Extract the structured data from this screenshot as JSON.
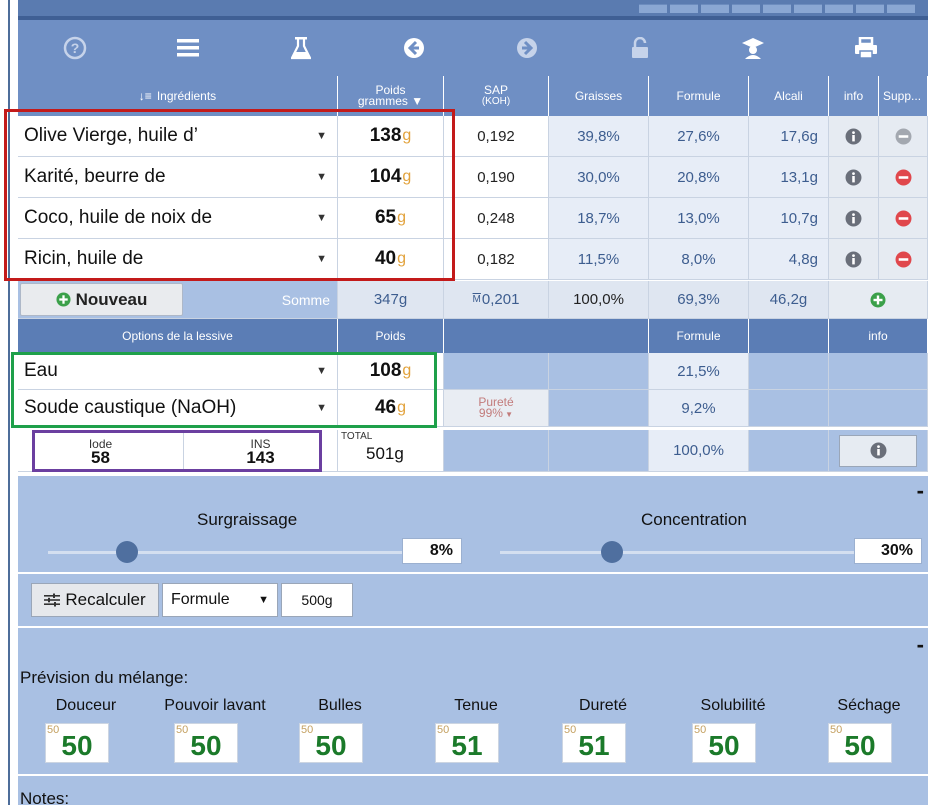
{
  "toolbar": {
    "icons": [
      "help-icon",
      "menu-icon",
      "flask-icon",
      "back-icon",
      "forward-icon",
      "unlock-icon",
      "graduation-icon",
      "print-icon"
    ]
  },
  "headers": {
    "ingredients": "Ingrédients",
    "poids": "Poids",
    "poids_sub": "grammes ▼",
    "sap": "SAP",
    "sap_sub": "(KOH)",
    "graisses": "Graisses",
    "formule": "Formule",
    "alcali": "Alcali",
    "info": "info",
    "supp": "Supp..."
  },
  "ingredients": [
    {
      "name": "Olive Vierge, huile d’",
      "weight": "138",
      "unit": "g",
      "sap": "0,192",
      "graisses": "39,8%",
      "formule": "27,6%",
      "alcali": "17,6g"
    },
    {
      "name": "Karité, beurre de",
      "weight": "104",
      "unit": "g",
      "sap": "0,190",
      "graisses": "30,0%",
      "formule": "20,8%",
      "alcali": "13,1g"
    },
    {
      "name": "Coco, huile de noix de",
      "weight": "65",
      "unit": "g",
      "sap": "0,248",
      "graisses": "18,7%",
      "formule": "13,0%",
      "alcali": "10,7g"
    },
    {
      "name": "Ricin, huile de",
      "weight": "40",
      "unit": "g",
      "sap": "0,182",
      "graisses": "11,5%",
      "formule": "8,0%",
      "alcali": "4,8g"
    }
  ],
  "totals_row": {
    "nouveau": "Nouveau",
    "somme": "Somme",
    "weight": "347g",
    "sap": "0,201",
    "sap_prefix": "M",
    "graisses": "100,0%",
    "formule": "69,3%",
    "alcali": "46,2g"
  },
  "lye_headers": {
    "options": "Options de la lessive",
    "poids": "Poids",
    "formule": "Formule",
    "info": "info"
  },
  "lye": [
    {
      "name": "Eau",
      "weight": "108",
      "unit": "g",
      "formule": "21,5%"
    },
    {
      "name": "Soude caustique (NaOH)",
      "weight": "46",
      "unit": "g",
      "purete_label": "Pureté",
      "purete_value": "99%",
      "formule": "9,2%"
    }
  ],
  "indices": {
    "iode_label": "Iode",
    "iode_value": "58",
    "ins_label": "INS",
    "ins_value": "143",
    "total_label": "TOTAL",
    "total_value": "501g",
    "formule": "100,0%"
  },
  "sliders": {
    "surgraissage_label": "Surgraissage",
    "surgraissage_value": "8%",
    "surgraissage_fraction": 0.08,
    "concentration_label": "Concentration",
    "concentration_value": "30%",
    "concentration_fraction": 0.3,
    "collapse": "-"
  },
  "recalc": {
    "button": "Recalculer",
    "mode": "Formule",
    "amount": "500g"
  },
  "prediction": {
    "title": "Prévision du mélange:",
    "collapse": "-",
    "items": [
      {
        "label": "Douceur",
        "value": "50",
        "ref": "50"
      },
      {
        "label": "Pouvoir lavant",
        "value": "50",
        "ref": "50"
      },
      {
        "label": "Bulles",
        "value": "50",
        "ref": "50"
      },
      {
        "label": "Tenue",
        "value": "51",
        "ref": "50"
      },
      {
        "label": "Dureté",
        "value": "51",
        "ref": "50"
      },
      {
        "label": "Solubilité",
        "value": "50",
        "ref": "50"
      },
      {
        "label": "Séchage",
        "value": "50",
        "ref": "50"
      }
    ]
  },
  "notes": {
    "label": "Notes:"
  },
  "colors": {
    "header": "#6f8fc4",
    "panel": "#a9c0e3",
    "gram": "#e2a23b",
    "remove": "#e0474c",
    "add": "#3ba04a",
    "score": "#1b7a2a"
  }
}
